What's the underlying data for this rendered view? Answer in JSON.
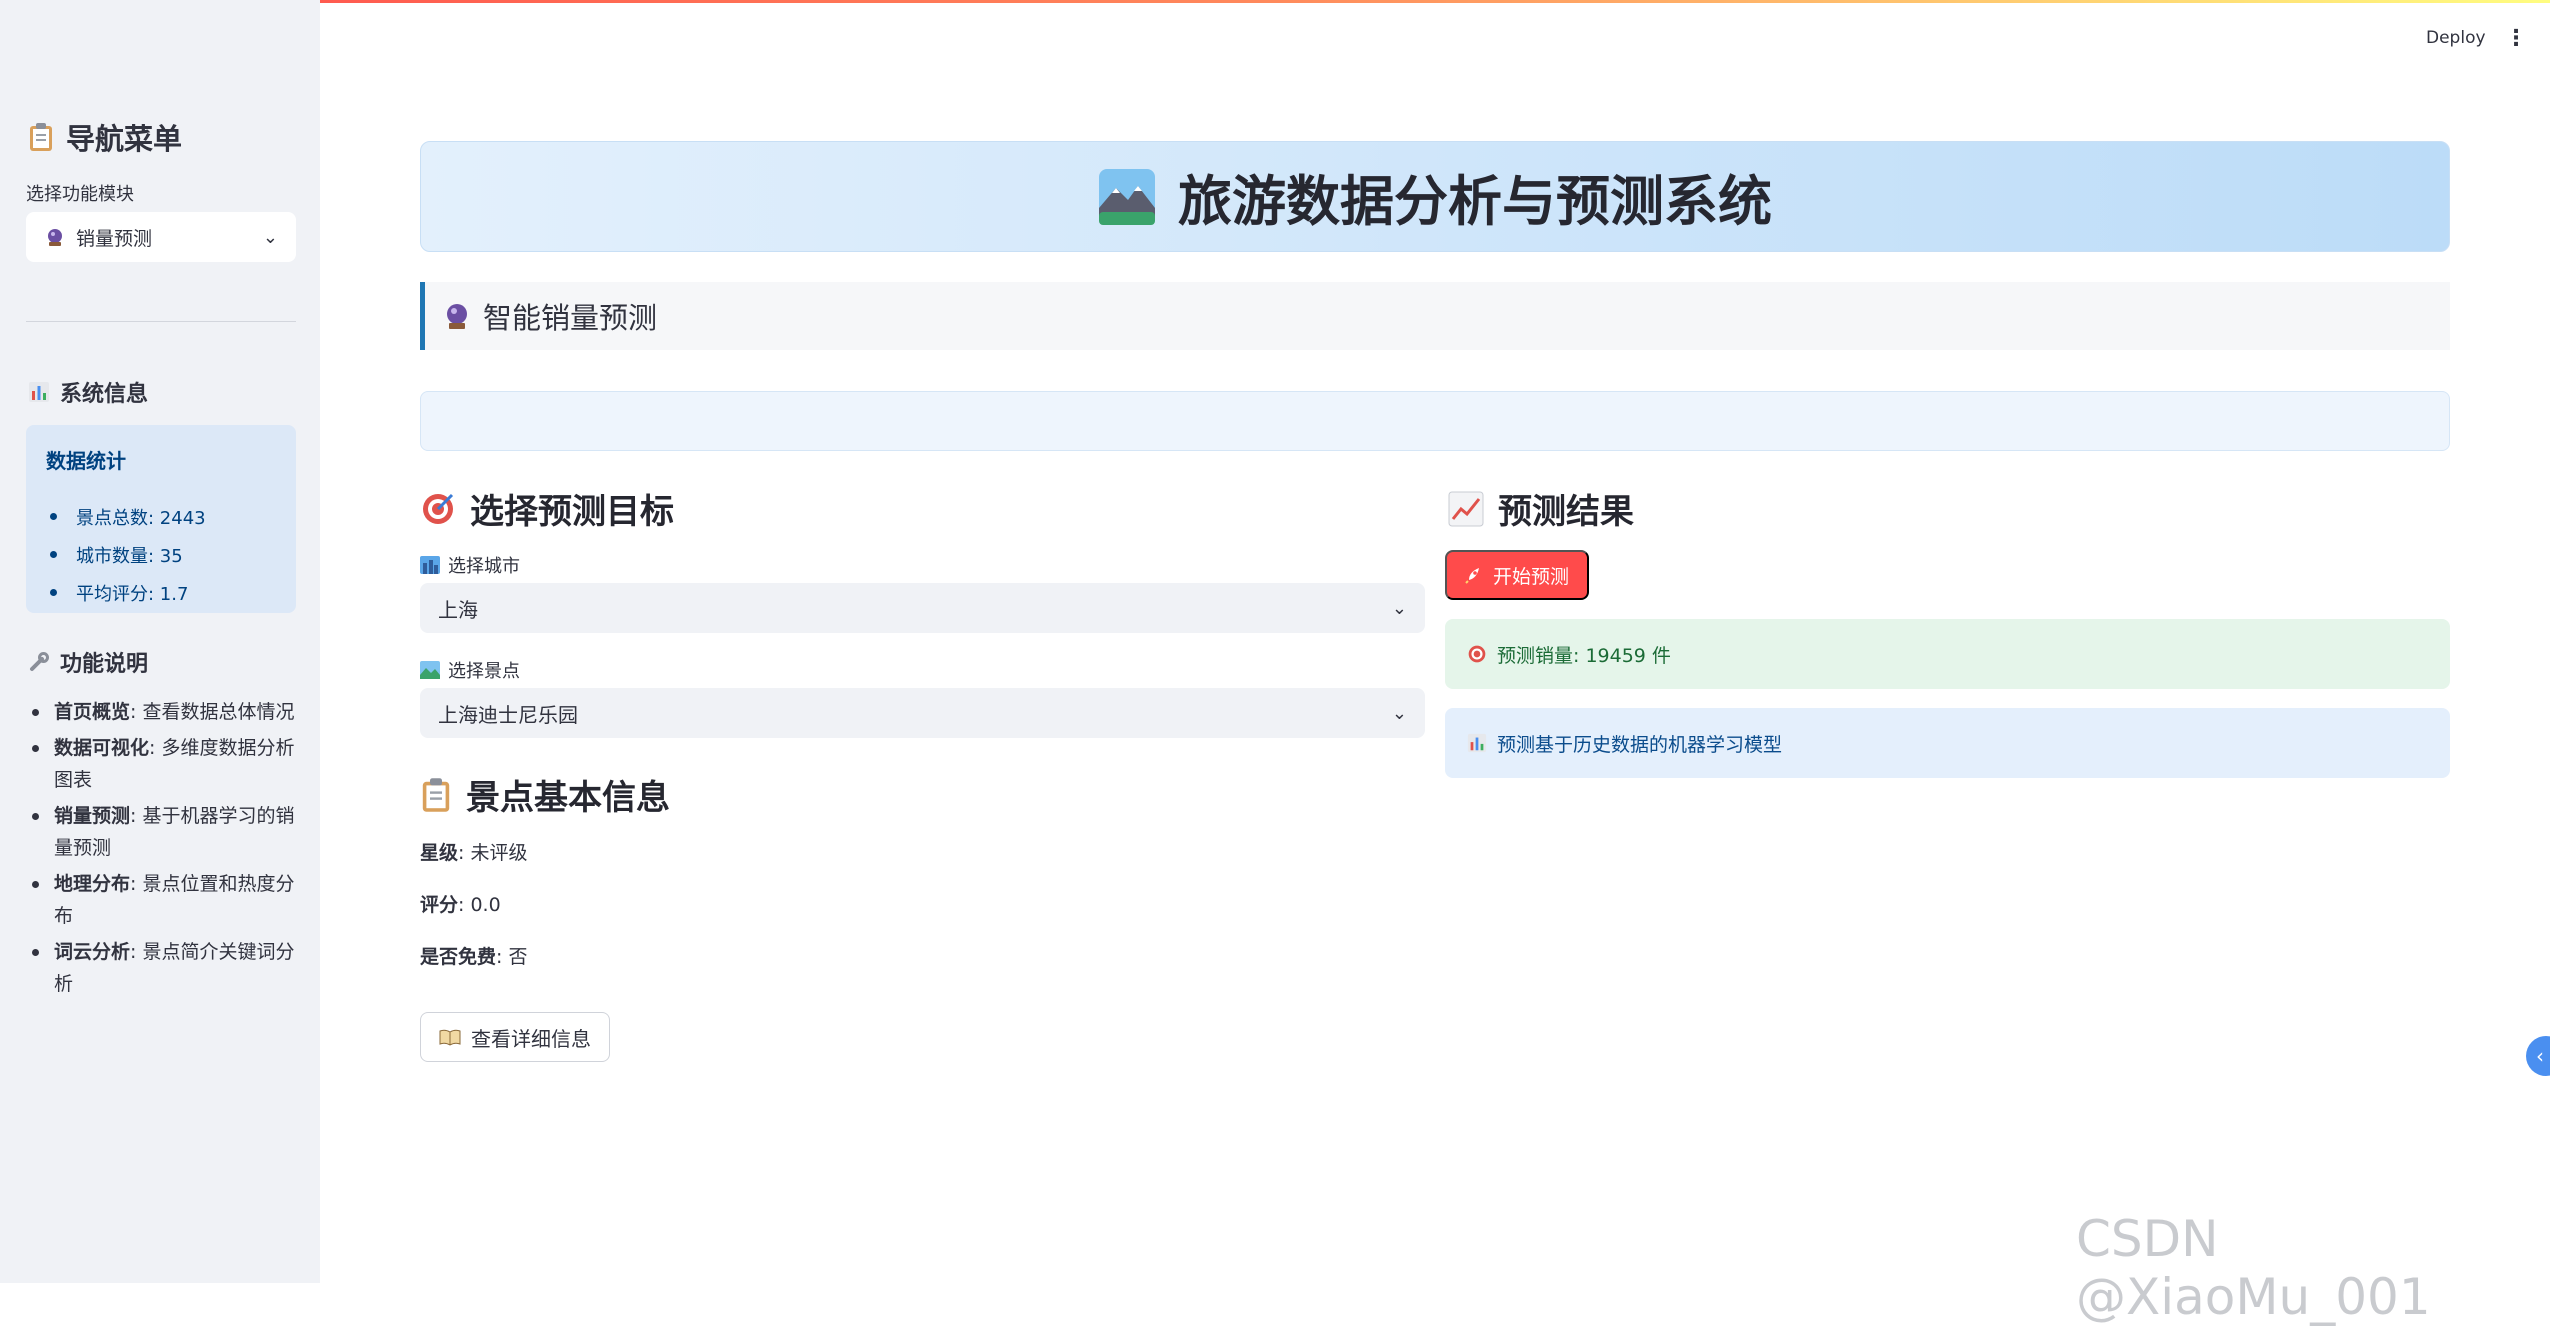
{
  "header": {
    "deploy_label": "Deploy",
    "menu_icon": "kebab-menu-icon"
  },
  "sidebar": {
    "nav_title": "导航菜单",
    "nav_icon": "clipboard-icon",
    "select_label": "选择功能模块",
    "select_value": "销量预测",
    "select_icon": "crystal-ball-icon",
    "system_info_title": "系统信息",
    "system_info_icon": "bar-chart-icon",
    "stats": {
      "title": "数据统计",
      "items": [
        "景点总数: 2443",
        "城市数量: 35",
        "平均评分: 1.7"
      ]
    },
    "features_title": "功能说明",
    "features_icon": "wrench-icon",
    "features": [
      {
        "name": "首页概览",
        "desc": ": 查看数据总体情况"
      },
      {
        "name": "数据可视化",
        "desc": ": 多维度数据分析图表"
      },
      {
        "name": "销量预测",
        "desc": ": 基于机器学习的销量预测"
      },
      {
        "name": "地理分布",
        "desc": ": 景点位置和热度分布"
      },
      {
        "name": "词云分析",
        "desc": ": 景点简介关键词分析"
      }
    ]
  },
  "main": {
    "banner_title": "旅游数据分析与预测系统",
    "banner_icon": "mountain-landscape-icon",
    "section_title": "智能销量预测",
    "section_icon": "crystal-ball-icon",
    "target": {
      "title": "选择预测目标",
      "icon": "target-icon",
      "city_label": "选择城市",
      "city_value": "上海",
      "spot_label": "选择景点",
      "spot_value": "上海迪士尼乐园"
    },
    "basic_info": {
      "title": "景点基本信息",
      "icon": "clipboard-icon",
      "star_label": "星级",
      "star_value": ": 未评级",
      "score_label": "评分",
      "score_value": ": 0.0",
      "free_label": "是否免费",
      "free_value": ": 否",
      "detail_button": "查看详细信息"
    },
    "result": {
      "title": "预测结果",
      "icon": "trending-up-icon",
      "start_button": "开始预测",
      "predicted_sales": "预测销量: 19459 件",
      "model_note": "预测基于历史数据的机器学习模型"
    }
  },
  "watermark": "CSDN @XiaoMu_001",
  "colors": {
    "primary": "#ff4b4b",
    "accent_blue": "#1f77b4",
    "success_bg": "#e5f5ea",
    "info_bg": "#e4effc"
  }
}
